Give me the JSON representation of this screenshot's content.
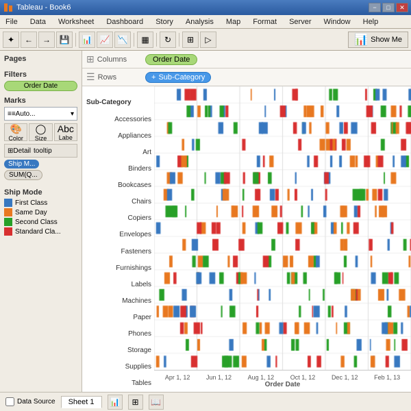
{
  "titleBar": {
    "title": "Tableau - Book6",
    "minBtn": "−",
    "maxBtn": "□",
    "closeBtn": "✕"
  },
  "menuBar": {
    "items": [
      "File",
      "Data",
      "Worksheet",
      "Dashboard",
      "Story",
      "Analysis",
      "Map",
      "Format",
      "Server",
      "Window",
      "Help"
    ]
  },
  "toolbar": {
    "showMeLabel": "Show Me"
  },
  "pages": {
    "label": "Pages"
  },
  "filters": {
    "label": "Filters",
    "items": [
      "Order Date"
    ]
  },
  "marks": {
    "label": "Marks",
    "dropdown": "Auto...",
    "buttons": [
      "Color",
      "Size",
      "Labe"
    ],
    "rows": [
      "Detail",
      "tooltip"
    ],
    "pills": [
      "Ship M...",
      "SUM(Q..."
    ]
  },
  "columns": {
    "label": "Columns",
    "pill": "Order Date"
  },
  "rows": {
    "label": "Rows",
    "pill": "Sub-Category"
  },
  "chart": {
    "rowHeaderLabel": "Sub-Category",
    "rows": [
      "Accessories",
      "Appliances",
      "Art",
      "Binders",
      "Bookcases",
      "Chairs",
      "Copiers",
      "Envelopes",
      "Fasteners",
      "Furnishings",
      "Labels",
      "Machines",
      "Paper",
      "Phones",
      "Storage",
      "Supplies",
      "Tables"
    ],
    "xLabels": [
      "Apr 1, 12",
      "Jun 1, 12",
      "Aug 1, 12",
      "Oct 1, 12",
      "Dec 1, 12",
      "Feb 1, 13"
    ],
    "xAxisLabel": "Order Date"
  },
  "shipMode": {
    "label": "Ship Mode",
    "items": [
      {
        "label": "First Class",
        "color": "#3878c0"
      },
      {
        "label": "Same Day",
        "color": "#e87820"
      },
      {
        "label": "Second Class",
        "color": "#28a028"
      },
      {
        "label": "Standard Cla...",
        "color": "#d83030"
      }
    ]
  },
  "statusBar": {
    "datasource": "Data Source",
    "sheet": "Sheet 1"
  }
}
